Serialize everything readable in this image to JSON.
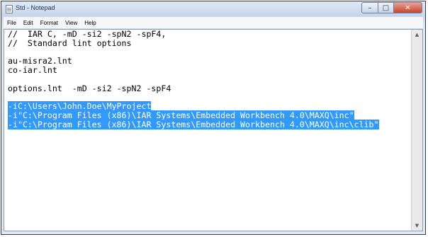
{
  "window": {
    "title": "Std - Notepad",
    "controls": {
      "minimize": "–",
      "maximize": "□",
      "close": "✕"
    }
  },
  "menu": [
    "File",
    "Edit",
    "Format",
    "View",
    "Help"
  ],
  "editor": {
    "lines": [
      {
        "text": "//  IAR C, -mD -si2 -spN2 -spF4,",
        "selected": false
      },
      {
        "text": "//  Standard lint options",
        "selected": false
      },
      {
        "text": "",
        "selected": false
      },
      {
        "text": "au-misra2.lnt",
        "selected": false
      },
      {
        "text": "co-iar.lnt",
        "selected": false
      },
      {
        "text": "",
        "selected": false
      },
      {
        "text": "options.lnt  -mD -si2 -spN2 -spF4",
        "selected": false
      },
      {
        "text": "",
        "selected": false
      },
      {
        "text": "-iC:\\Users\\John.Doe\\MyProject",
        "selected": true
      },
      {
        "text": "-i\"C:\\Program Files (x86)\\IAR Systems\\Embedded Workbench 4.0\\MAXQ\\inc\"",
        "selected": true
      },
      {
        "text": "-i\"C:\\Program Files (x86)\\IAR Systems\\Embedded Workbench 4.0\\MAXQ\\inc\\clib\"",
        "selected": true
      }
    ],
    "selection_color": "#3399ff"
  },
  "scrollbar": {
    "up_arrow": "▲",
    "down_arrow": "▼"
  }
}
